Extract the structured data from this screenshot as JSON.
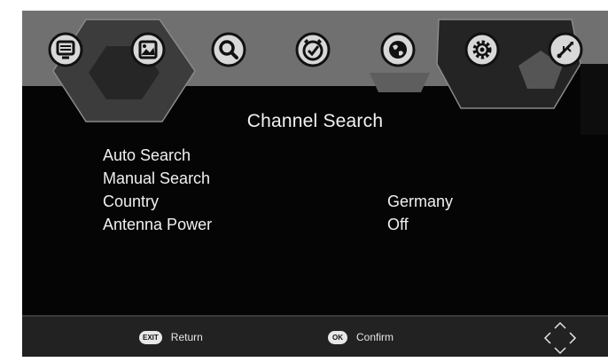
{
  "header": {
    "icons": [
      {
        "name": "tv-program-icon",
        "glyph": "monitor"
      },
      {
        "name": "picture-icon",
        "glyph": "picture"
      },
      {
        "name": "search-icon",
        "glyph": "search"
      },
      {
        "name": "time-icon",
        "glyph": "clock"
      },
      {
        "name": "globe-icon",
        "glyph": "globe"
      },
      {
        "name": "settings-icon",
        "glyph": "gear"
      },
      {
        "name": "usb-icon",
        "glyph": "usb"
      }
    ],
    "selected_index": 5
  },
  "page": {
    "title": "Channel Search"
  },
  "menu": {
    "items": [
      {
        "label": "Auto Search",
        "value": ""
      },
      {
        "label": "Manual Search",
        "value": ""
      },
      {
        "label": "Country",
        "value": "Germany"
      },
      {
        "label": "Antenna Power",
        "value": "Off"
      }
    ]
  },
  "footer": {
    "exit_key": "EXIT",
    "exit_label": "Return",
    "ok_key": "OK",
    "ok_label": "Confirm",
    "nav_icon": "dpad-arrows-icon"
  },
  "colors": {
    "screen_bg": "#050505",
    "panel_gray": "#6e6e6e",
    "text": "#f0f0f0",
    "footer_bg": "#222222"
  }
}
